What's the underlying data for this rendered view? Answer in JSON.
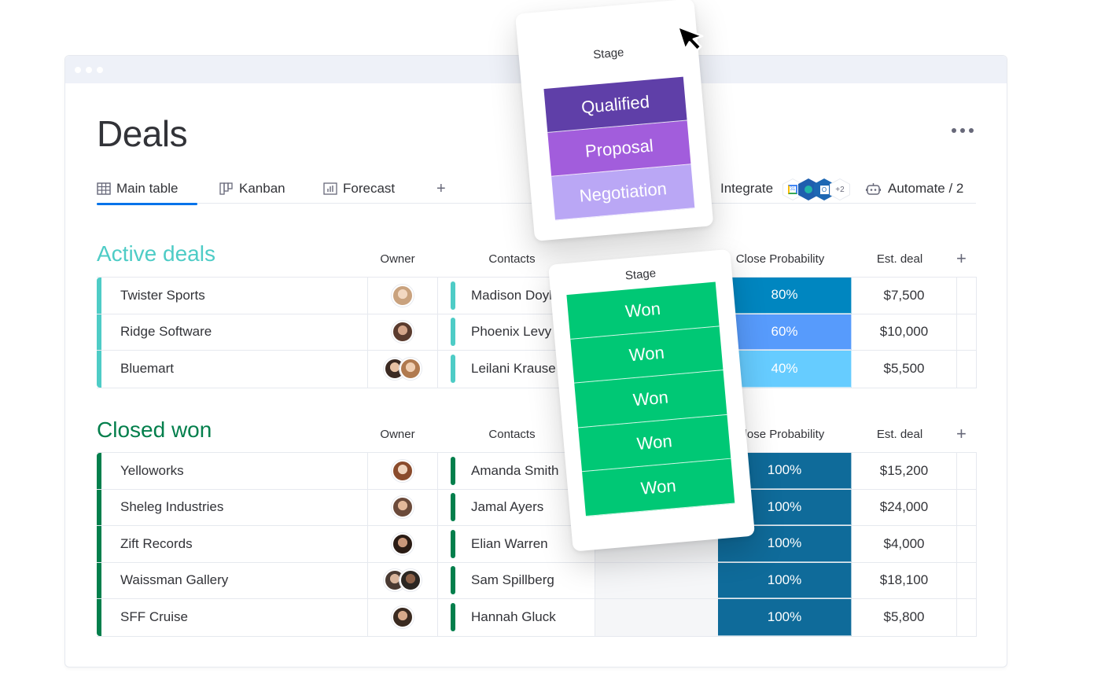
{
  "window": {
    "controls": [
      "dot",
      "dot",
      "dot"
    ]
  },
  "page": {
    "title": "Deals",
    "more_icon": "more-horizontal-icon"
  },
  "tabs": {
    "items": [
      {
        "label": "Main table",
        "icon": "table-icon",
        "active": true
      },
      {
        "label": "Kanban",
        "icon": "kanban-icon",
        "active": false
      },
      {
        "label": "Forecast",
        "icon": "chart-icon",
        "active": false
      }
    ],
    "add_label": "+",
    "integrate_label": "Integrate",
    "integrations": [
      {
        "name": "google-calendar-icon",
        "label": "31",
        "color": "#ffffff"
      },
      {
        "name": "app-icon",
        "label": "",
        "color": "#1f5eae"
      },
      {
        "name": "outlook-icon",
        "label": "O",
        "color": "#1c67b3"
      },
      {
        "name": "more-integrations",
        "label": "+2",
        "color": "#ffffff"
      }
    ],
    "automate_label": "Automate / 2"
  },
  "groups": [
    {
      "title": "Active deals",
      "color": "#4eccc6",
      "columns": {
        "owner": "Owner",
        "contacts": "Contacts",
        "stage": "Stage",
        "probability": "Close Probability",
        "deal": "Est. deal",
        "add": "+"
      },
      "rows": [
        {
          "name": "Twister Sports",
          "owners": [
            [
              "#c9a27e",
              "#f2d8c2"
            ]
          ],
          "contact": "Madison Doyle",
          "stage": "Qualified",
          "probability": "80%",
          "prob_color": "#0086c0",
          "deal": "$7,500"
        },
        {
          "name": "Ridge Software",
          "owners": [
            [
              "#5a3b2e",
              "#d4a58a"
            ]
          ],
          "contact": "Phoenix Levy",
          "stage": "Proposal",
          "probability": "60%",
          "prob_color": "#579bfc",
          "deal": "$10,000"
        },
        {
          "name": "Bluemart",
          "owners": [
            [
              "#3b2a22",
              "#e7c1a3"
            ],
            [
              "#b07a4f",
              "#f0cfb2"
            ]
          ],
          "contact": "Leilani Krause",
          "stage": "Negotiation",
          "probability": "40%",
          "prob_color": "#66ccff",
          "deal": "$5,500"
        }
      ]
    },
    {
      "title": "Closed won",
      "color": "#037f4c",
      "columns": {
        "owner": "Owner",
        "contacts": "Contacts",
        "stage": "Stage",
        "probability": "Close Probability",
        "deal": "Est. deal",
        "add": "+"
      },
      "rows": [
        {
          "name": "Yelloworks",
          "owners": [
            [
              "#8a4b2c",
              "#efd3bd"
            ]
          ],
          "contact": "Amanda Smith",
          "stage": "Won",
          "probability": "100%",
          "prob_color": "#0f6b9a",
          "deal": "$15,200"
        },
        {
          "name": "Sheleg Industries",
          "owners": [
            [
              "#6b4a3a",
              "#e3b89a"
            ]
          ],
          "contact": "Jamal Ayers",
          "stage": "Won",
          "probability": "100%",
          "prob_color": "#0f6b9a",
          "deal": "$24,000"
        },
        {
          "name": "Zift Records",
          "owners": [
            [
              "#2a1b14",
              "#c9977a"
            ]
          ],
          "contact": "Elian Warren",
          "stage": "Won",
          "probability": "100%",
          "prob_color": "#0f6b9a",
          "deal": "$4,000"
        },
        {
          "name": "Waissman Gallery",
          "owners": [
            [
              "#4a3a32",
              "#d9b59c"
            ],
            [
              "#2b2622",
              "#8b6048"
            ]
          ],
          "contact": "Sam Spillberg",
          "stage": "Won",
          "probability": "100%",
          "prob_color": "#0f6b9a",
          "deal": "$18,100"
        },
        {
          "name": "SFF Cruise",
          "owners": [
            [
              "#3a2a20",
              "#d7a98a"
            ]
          ],
          "contact": "Hannah Gluck",
          "stage": "Won",
          "probability": "100%",
          "prob_color": "#0f6b9a",
          "deal": "$5,800"
        }
      ]
    }
  ],
  "dragged_cards": [
    {
      "label": "Stage",
      "cells": [
        {
          "label": "Qualified",
          "color": "#5f3fa8"
        },
        {
          "label": "Proposal",
          "color": "#a25ddc"
        },
        {
          "label": "Negotiation",
          "color": "#baa7f5"
        }
      ]
    },
    {
      "label": "Stage",
      "cells": [
        {
          "label": "Won",
          "color": "#00c875"
        },
        {
          "label": "Won",
          "color": "#00c875"
        },
        {
          "label": "Won",
          "color": "#00c875"
        },
        {
          "label": "Won",
          "color": "#00c875"
        },
        {
          "label": "Won",
          "color": "#00c875"
        }
      ]
    }
  ],
  "cursor": {
    "icon": "mouse-pointer-icon"
  }
}
